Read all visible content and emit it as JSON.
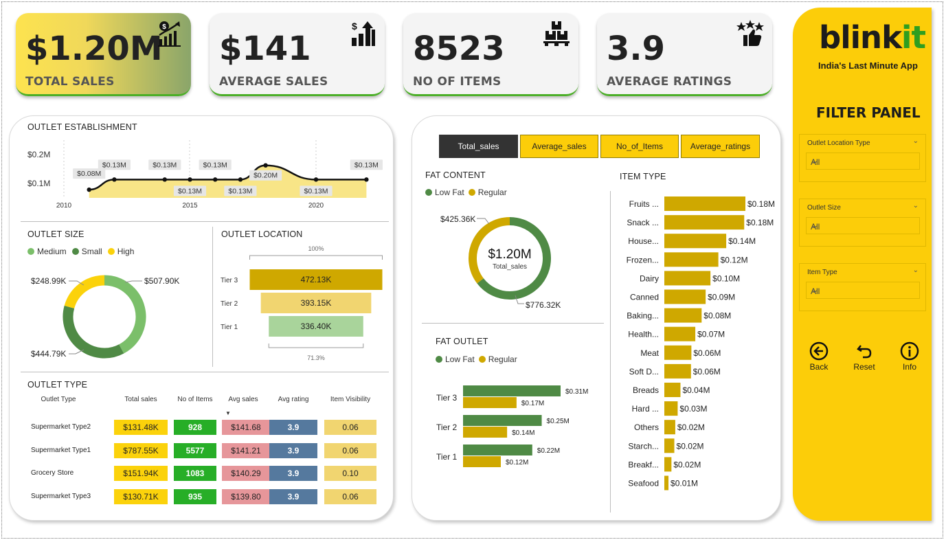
{
  "kpis": [
    {
      "value": "$1.20M",
      "label": "TOTAL SALES",
      "icon": "sales-chart-icon"
    },
    {
      "value": "$141",
      "label": "AVERAGE SALES",
      "icon": "dollar-bars-icon"
    },
    {
      "value": "8523",
      "label": "NO OF ITEMS",
      "icon": "boxes-pallet-icon"
    },
    {
      "value": "3.9",
      "label": "AVERAGE RATINGS",
      "icon": "stars-thumb-icon"
    }
  ],
  "establishment": {
    "title": "OUTLET ESTABLISHMENT",
    "chart_data": {
      "type": "area",
      "x": [
        2011,
        2012,
        2014,
        2015,
        2016,
        2017,
        2018,
        2020,
        2022
      ],
      "values": [
        0.08,
        0.13,
        0.13,
        0.13,
        0.13,
        0.13,
        0.2,
        0.13,
        0.13
      ],
      "labels": [
        "$0.08M",
        "$0.13M",
        "$0.13M",
        "$0.13M",
        "$0.13M",
        "$0.13M",
        "$0.20M",
        "$0.13M",
        "$0.13M"
      ],
      "xticks": [
        "2010",
        "2015",
        "2020"
      ],
      "yticks": [
        "$0.2M",
        "$0.1M"
      ]
    }
  },
  "outlet_size": {
    "title": "OUTLET SIZE",
    "legend": [
      {
        "name": "Medium",
        "color": "#7bbf6a"
      },
      {
        "name": "Small",
        "color": "#4f8a45"
      },
      {
        "name": "High",
        "color": "#fbd20b"
      }
    ],
    "chart_data": {
      "type": "pie",
      "labels": [
        "Medium",
        "Small",
        "High"
      ],
      "values": [
        507.9,
        444.79,
        248.99
      ],
      "display": [
        "$507.90K",
        "$444.79K",
        "$248.99K"
      ]
    }
  },
  "outlet_location": {
    "title": "OUTLET LOCATION",
    "top_pct": "100%",
    "bottom_pct": "71.3%",
    "chart_data": {
      "type": "bar",
      "categories": [
        "Tier 3",
        "Tier 2",
        "Tier 1"
      ],
      "values": [
        472.13,
        393.15,
        336.4
      ],
      "display": [
        "472.13K",
        "393.15K",
        "336.40K"
      ],
      "colors": [
        "#cfa800",
        "#f1d570",
        "#a9d49b"
      ]
    }
  },
  "outlet_type": {
    "title": "OUTLET TYPE",
    "headers": [
      "Outlet Type",
      "Total sales",
      "No of Items",
      "Avg sales",
      "Avg rating",
      "Item Visibility"
    ],
    "sort_arrow": "▼",
    "rows": [
      {
        "name": "Supermarket Type2",
        "sales": "$131.48K",
        "items": "928",
        "avg": "$141.68",
        "rating": "3.9",
        "vis": "0.06"
      },
      {
        "name": "Supermarket Type1",
        "sales": "$787.55K",
        "items": "5577",
        "avg": "$141.21",
        "rating": "3.9",
        "vis": "0.06"
      },
      {
        "name": "Grocery Store",
        "sales": "$151.94K",
        "items": "1083",
        "avg": "$140.29",
        "rating": "3.9",
        "vis": "0.10"
      },
      {
        "name": "Supermarket Type3",
        "sales": "$130.71K",
        "items": "935",
        "avg": "$139.80",
        "rating": "3.9",
        "vis": "0.06"
      }
    ]
  },
  "tabs": [
    "Total_sales",
    "Average_sales",
    "No_of_Items",
    "Average_ratings"
  ],
  "fat_content": {
    "title": "FAT CONTENT",
    "legend": [
      {
        "name": "Low Fat",
        "color": "#4f8a45"
      },
      {
        "name": "Regular",
        "color": "#cfa800"
      }
    ],
    "center_value": "$1.20M",
    "center_label": "Total_sales",
    "chart_data": {
      "type": "pie",
      "labels": [
        "Low Fat",
        "Regular"
      ],
      "values": [
        776.32,
        425.36
      ],
      "display": [
        "$776.32K",
        "$425.36K"
      ]
    }
  },
  "fat_outlet": {
    "title": "FAT OUTLET",
    "legend": [
      {
        "name": "Low Fat",
        "color": "#4f8a45"
      },
      {
        "name": "Regular",
        "color": "#cfa800"
      }
    ],
    "chart_data": {
      "type": "bar",
      "categories": [
        "Tier 3",
        "Tier 2",
        "Tier 1"
      ],
      "series": [
        {
          "name": "Low Fat",
          "values": [
            0.31,
            0.25,
            0.22
          ],
          "display": [
            "$0.31M",
            "$0.25M",
            "$0.22M"
          ]
        },
        {
          "name": "Regular",
          "values": [
            0.17,
            0.14,
            0.12
          ],
          "display": [
            "$0.17M",
            "$0.14M",
            "$0.12M"
          ]
        }
      ]
    }
  },
  "item_type": {
    "title": "ITEM TYPE",
    "chart_data": {
      "type": "bar",
      "categories": [
        "Fruits ...",
        "Snack ...",
        "House...",
        "Frozen...",
        "Dairy",
        "Canned",
        "Baking...",
        "Health...",
        "Meat",
        "Soft D...",
        "Breads",
        "Hard ...",
        "Others",
        "Starch...",
        "Breakf...",
        "Seafood"
      ],
      "values": [
        0.18,
        0.18,
        0.14,
        0.12,
        0.1,
        0.09,
        0.08,
        0.07,
        0.06,
        0.06,
        0.04,
        0.03,
        0.02,
        0.02,
        0.02,
        0.01
      ],
      "display": [
        "$0.18M",
        "$0.18M",
        "$0.14M",
        "$0.12M",
        "$0.10M",
        "$0.09M",
        "$0.08M",
        "$0.07M",
        "$0.06M",
        "$0.06M",
        "$0.04M",
        "$0.03M",
        "$0.02M",
        "$0.02M",
        "$0.02M",
        "$0.01M"
      ],
      "raw": [
        178.0,
        175.4,
        135.9,
        118.6,
        101.3,
        90.7,
        81.9,
        68.0,
        59.4,
        58.5,
        35.4,
        29.3,
        24.0,
        21.9,
        15.6,
        9.1
      ]
    }
  },
  "sidebar": {
    "logo_main": "blink",
    "logo_accent": "it",
    "tagline": "India's Last Minute App",
    "filter_title": "FILTER PANEL",
    "filters": [
      {
        "label": "Outlet Location Type",
        "value": "All"
      },
      {
        "label": "Outlet Size",
        "value": "All"
      },
      {
        "label": "Item Type",
        "value": "All"
      }
    ],
    "buttons": [
      "Back",
      "Reset",
      "Info"
    ]
  }
}
